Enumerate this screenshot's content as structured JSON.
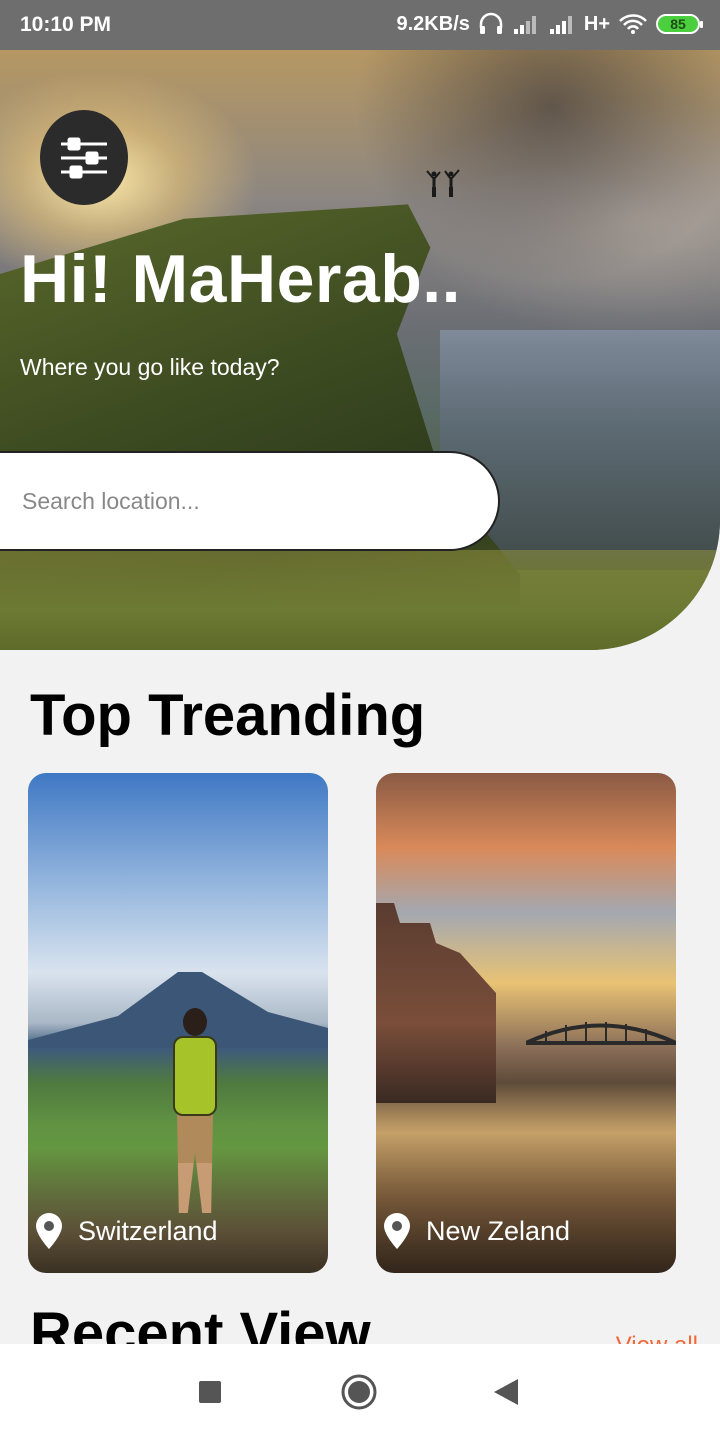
{
  "status_bar": {
    "time": "10:10 PM",
    "network_speed": "9.2KB/s",
    "network_type": "H+",
    "battery": "85",
    "icons": [
      "headphones-icon",
      "signal-icon",
      "signal-icon",
      "wifi-icon",
      "battery-icon"
    ]
  },
  "hero": {
    "greeting": "Hi! MaHerab..",
    "subtitle": "Where you go like today?",
    "menu_icon": "sliders-icon"
  },
  "search": {
    "placeholder": "Search location..."
  },
  "trending": {
    "title": "Top Treanding",
    "cards": [
      {
        "label": "Switzerland",
        "icon": "location-pin-icon"
      },
      {
        "label": "New Zeland",
        "icon": "location-pin-icon"
      }
    ]
  },
  "recent": {
    "title": "Recent View",
    "view_all": "View all"
  },
  "navigation": {
    "icons": [
      "recents-square-icon",
      "home-circle-icon",
      "back-triangle-icon"
    ]
  },
  "colors": {
    "accent": "#ef6a3a",
    "menu_button": "#2b2b2b",
    "status_bar": "#6e6e6e"
  }
}
